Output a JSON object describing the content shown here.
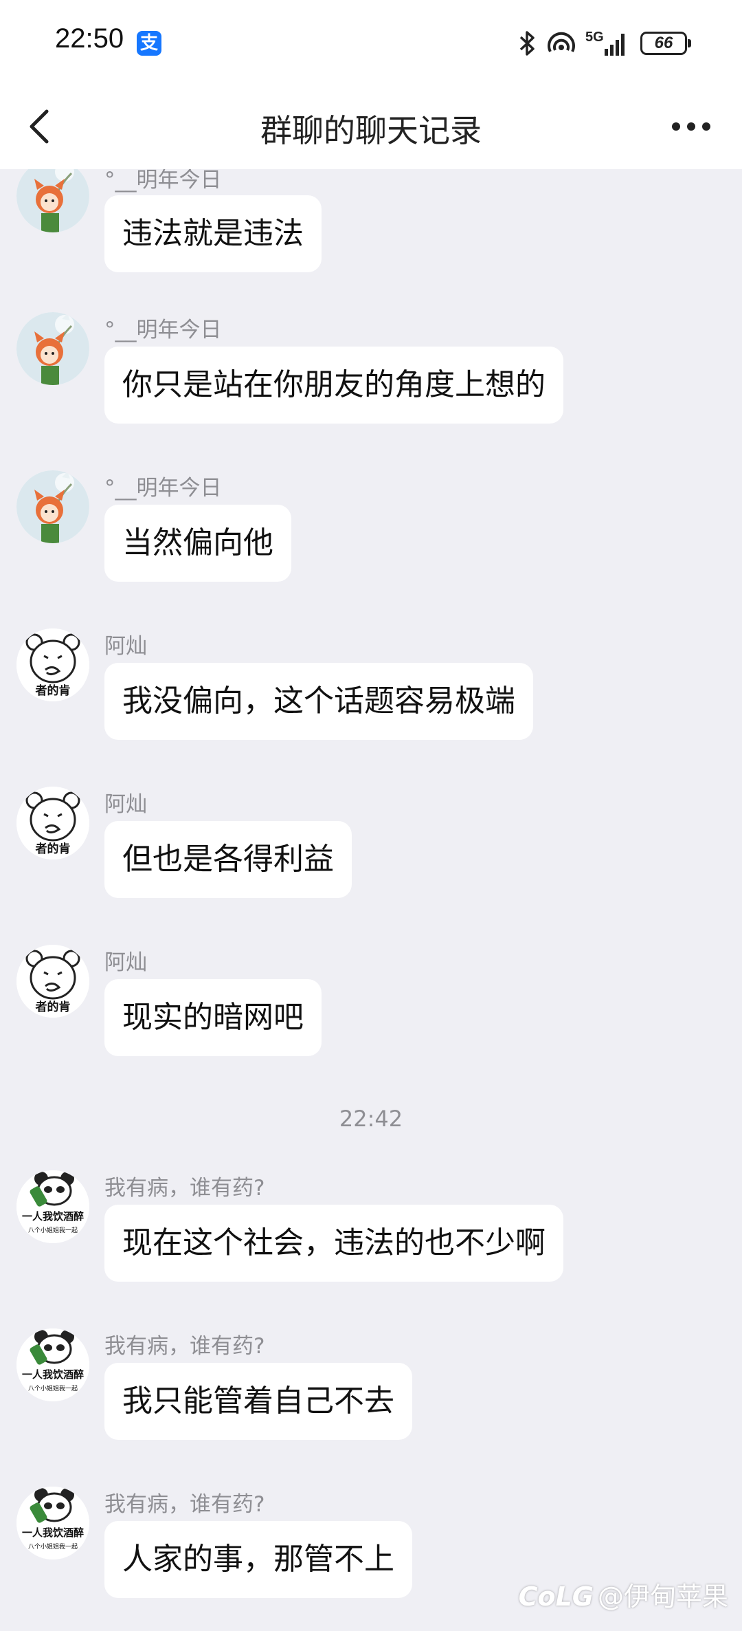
{
  "status_bar": {
    "time": "22:50",
    "alipay_icon_text": "支",
    "network_label": "5G",
    "battery": "66",
    "icons": [
      "alipay-icon",
      "bluetooth-icon",
      "hotspot-icon",
      "signal-icon",
      "battery-icon"
    ]
  },
  "header": {
    "title": "群聊的聊天记录",
    "back_icon": "chevron-left-icon",
    "more_icon": "more-dots-icon"
  },
  "messages": [
    {
      "sender": "°__明年今日",
      "text": "违法就是违法",
      "avatar": "fox-girl-avatar"
    },
    {
      "sender": "°__明年今日",
      "text": "你只是站在你朋友的角度上想的",
      "avatar": "fox-girl-avatar"
    },
    {
      "sender": "°__明年今日",
      "text": "当然偏向他",
      "avatar": "fox-girl-avatar"
    },
    {
      "sender": "阿灿",
      "text": "我没偏向，这个话题容易极端",
      "avatar": "bear-meme-avatar"
    },
    {
      "sender": "阿灿",
      "text": "但也是各得利益",
      "avatar": "bear-meme-avatar"
    },
    {
      "sender": "阿灿",
      "text": "现实的暗网吧",
      "avatar": "bear-meme-avatar"
    },
    {
      "sender": "我有病，谁有药?",
      "text": "现在这个社会，违法的也不少啊",
      "avatar": "panda-meme-avatar"
    },
    {
      "sender": "我有病，谁有药?",
      "text": "我只能管着自己不去",
      "avatar": "panda-meme-avatar"
    },
    {
      "sender": "我有病，谁有药?",
      "text": "人家的事，那管不上",
      "avatar": "panda-meme-avatar"
    }
  ],
  "timestamp": "22:42",
  "avatar_texts": {
    "bear": "者的肯",
    "panda_line1": "一人我饮酒醉",
    "panda_line2": "八个小姐姐我一起"
  },
  "watermark": "@伊甸苹果",
  "watermark_logo": "CoLG"
}
